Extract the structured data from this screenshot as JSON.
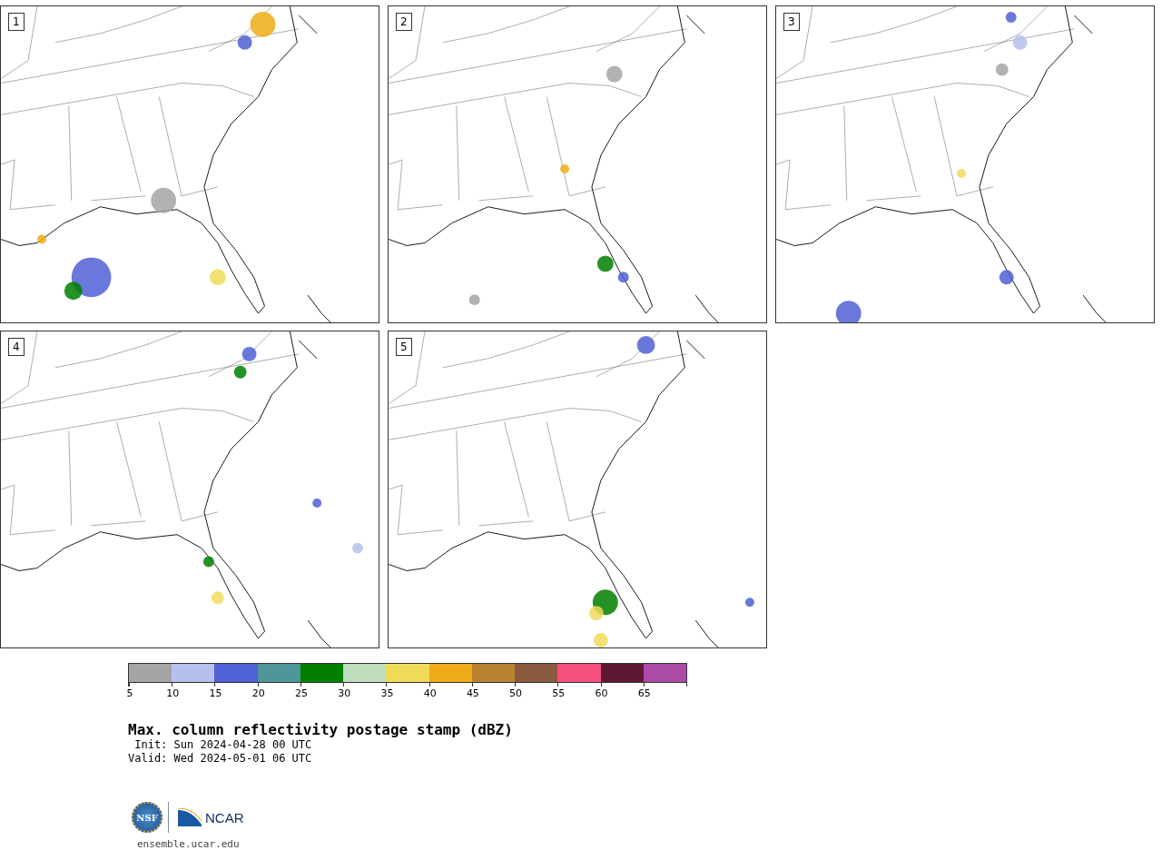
{
  "panels": [
    {
      "label": "1"
    },
    {
      "label": "2"
    },
    {
      "label": "3"
    },
    {
      "label": "4"
    },
    {
      "label": "5"
    }
  ],
  "colorbar": {
    "bins": [
      {
        "color": "#a5a5a5",
        "tick": "5"
      },
      {
        "color": "#b5c0ec",
        "tick": "10"
      },
      {
        "color": "#5060d6",
        "tick": "15"
      },
      {
        "color": "#4e969a",
        "tick": "20"
      },
      {
        "color": "#007f00",
        "tick": "25"
      },
      {
        "color": "#bfdcbc",
        "tick": "30"
      },
      {
        "color": "#f0da5a",
        "tick": "35"
      },
      {
        "color": "#f0ab18",
        "tick": "40"
      },
      {
        "color": "#b98230",
        "tick": "45"
      },
      {
        "color": "#8b5a3e",
        "tick": "50"
      },
      {
        "color": "#f44f7e",
        "tick": "55"
      },
      {
        "color": "#5f1735",
        "tick": "60"
      },
      {
        "color": "#ac4ba6",
        "tick": "65"
      }
    ]
  },
  "title": "Max. column reflectivity postage stamp (dBZ)",
  "init": " Init: Sun 2024-04-28 00 UTC",
  "valid": "Valid: Wed 2024-05-01 06 UTC",
  "logos": {
    "nsf": "NSF",
    "ncar": "NCAR"
  },
  "url": "ensemble.ucar.edu"
}
